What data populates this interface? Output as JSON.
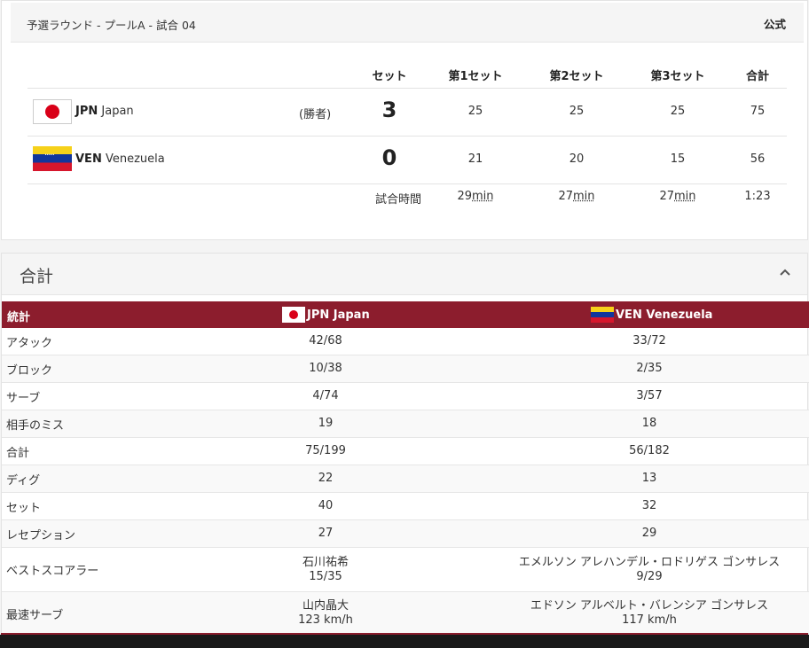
{
  "match": {
    "title": "予選ラウンド - プールA  - 試合 04",
    "status": "公式",
    "headers": [
      "セット",
      "第1セット",
      "第2セット",
      "第3セット",
      "合計"
    ],
    "teams": [
      {
        "code": "JPN",
        "name": "Japan",
        "winner_label": "(勝者)",
        "sets": "3",
        "s1": "25",
        "s2": "25",
        "s3": "25",
        "total": "75"
      },
      {
        "code": "VEN",
        "name": "Venezuela",
        "winner_label": "",
        "sets": "0",
        "s1": "21",
        "s2": "20",
        "s3": "15",
        "total": "56"
      }
    ],
    "duration": {
      "label": "試合時間",
      "s1_num": "29",
      "s2_num": "27",
      "s3_num": "27",
      "unit": "min",
      "total": "1:23"
    }
  },
  "summary": {
    "title": "合計",
    "caret_icon": "chevron-up-icon",
    "stat_label": "統計",
    "team1": "JPN Japan",
    "team2": "VEN Venezuela",
    "rows": [
      {
        "name": "アタック",
        "v1": "42/68",
        "v2": "33/72"
      },
      {
        "name": "ブロック",
        "v1": "10/38",
        "v2": "2/35"
      },
      {
        "name": "サーブ",
        "v1": "4/74",
        "v2": "3/57"
      },
      {
        "name": "相手のミス",
        "v1": "19",
        "v2": "18"
      },
      {
        "name": "合計",
        "v1": "75/199",
        "v2": "56/182"
      },
      {
        "name": "ディグ",
        "v1": "22",
        "v2": "13"
      },
      {
        "name": "セット",
        "v1": "40",
        "v2": "32"
      },
      {
        "name": "レセプション",
        "v1": "27",
        "v2": "29"
      }
    ],
    "best_scorer": {
      "name": "ベストスコアラー",
      "p1": "石川祐希",
      "v1": "15/35",
      "p2": "エメルソン アレハンデル・ロドリゲス ゴンサレス",
      "v2": "9/29"
    },
    "fastest_serve": {
      "name": "最速サーブ",
      "p1": "山内晶大",
      "v1": "123 km/h",
      "p2": "エドソン アルベルト・バレンシア ゴンサレス",
      "v2": "117 km/h"
    }
  },
  "colors": {
    "accent": "#8c1d2d",
    "jp_red": "#d90018"
  }
}
